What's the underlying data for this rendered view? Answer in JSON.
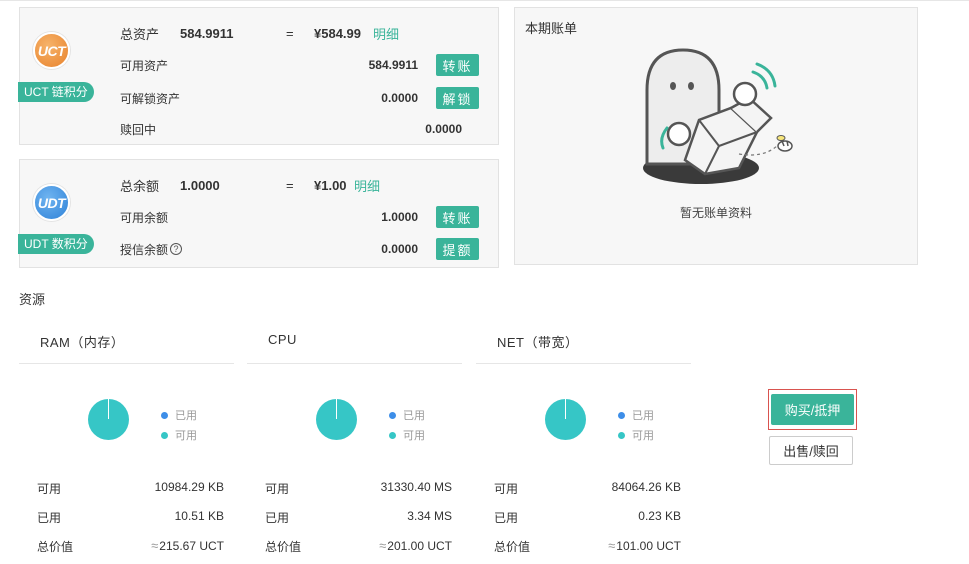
{
  "uct": {
    "coin_text": "UCT",
    "tag": "UCT 链积分",
    "total_label": "总资产",
    "total_value": "584.9911",
    "equals": "=",
    "fiat": "¥584.99",
    "detail": "明细",
    "rows": [
      {
        "label": "可用资产",
        "value": "584.9911",
        "button": "转账"
      },
      {
        "label": "可解锁资产",
        "value": "0.0000",
        "button": "解锁"
      },
      {
        "label": "赎回中",
        "value": "0.0000"
      }
    ]
  },
  "udt": {
    "coin_text": "UDT",
    "tag": "UDT 数积分",
    "total_label": "总余额",
    "total_value": "1.0000",
    "equals": "=",
    "fiat": "¥1.00",
    "detail": "明细",
    "rows": [
      {
        "label": "可用余额",
        "value": "1.0000",
        "button": "转账"
      },
      {
        "label": "授信余额",
        "help": "?",
        "value": "0.0000",
        "button": "提额"
      }
    ]
  },
  "bill": {
    "title": "本期账单",
    "empty_text": "暂无账单资料"
  },
  "resources": {
    "title": "资源",
    "legend_used": "已用",
    "legend_available": "可用",
    "used_color": "#3d8ee8",
    "available_color": "#36c6c6",
    "items": [
      {
        "name": "RAM（内存）",
        "usage_fraction": 0.001,
        "available_label": "可用",
        "available": "10984.29 KB",
        "used_label": "已用",
        "used": "10.51 KB",
        "value_label": "总价值",
        "approx": "≈",
        "value": "215.67 UCT"
      },
      {
        "name": "CPU",
        "usage_fraction": 0.0001,
        "available_label": "可用",
        "available": "31330.40 MS",
        "used_label": "已用",
        "used": "3.34 MS",
        "value_label": "总价值",
        "approx": "≈",
        "value": "201.00 UCT"
      },
      {
        "name": "NET（带宽）",
        "usage_fraction": 1e-05,
        "available_label": "可用",
        "available": "84064.26 KB",
        "used_label": "已用",
        "used": "0.23 KB",
        "value_label": "总价值",
        "approx": "≈",
        "value": "101.00 UCT"
      }
    ]
  },
  "actions": {
    "buy": "购买/抵押",
    "sell": "出售/赎回"
  }
}
